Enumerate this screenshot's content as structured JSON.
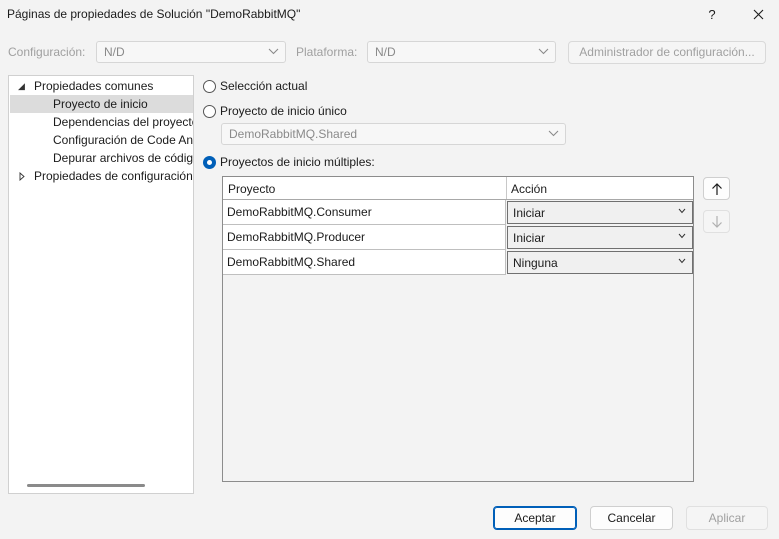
{
  "window": {
    "title": "Páginas de propiedades de Solución \"DemoRabbitMQ\"",
    "help_glyph": "?",
    "close_glyph": "✕"
  },
  "config_bar": {
    "configuration_label": "Configuración:",
    "configuration_value": "N/D",
    "platform_label": "Plataforma:",
    "platform_value": "N/D",
    "config_manager_label": "Administrador de configuración..."
  },
  "tree": {
    "items": [
      {
        "label": "Propiedades comunes",
        "expanded": true
      },
      {
        "label": "Proyecto de inicio",
        "selected": true
      },
      {
        "label": "Dependencias del proyecto"
      },
      {
        "label": "Configuración de Code Analysis"
      },
      {
        "label": "Depurar archivos de código fuente"
      },
      {
        "label": "Propiedades de configuración",
        "expanded": false
      }
    ]
  },
  "startup": {
    "current_selection_label": "Selección actual",
    "single_label": "Proyecto de inicio único",
    "single_value": "DemoRabbitMQ.Shared",
    "multiple_label": "Proyectos de inicio múltiples:",
    "selected_option": "multiple"
  },
  "grid": {
    "headers": {
      "project": "Proyecto",
      "action": "Acción"
    },
    "rows": [
      {
        "project": "DemoRabbitMQ.Consumer",
        "action": "Iniciar"
      },
      {
        "project": "DemoRabbitMQ.Producer",
        "action": "Iniciar"
      },
      {
        "project": "DemoRabbitMQ.Shared",
        "action": "Ninguna"
      }
    ]
  },
  "move": {
    "up_glyph": "↑",
    "down_glyph": "↓"
  },
  "buttons": {
    "ok": "Aceptar",
    "cancel": "Cancelar",
    "apply": "Aplicar"
  },
  "colors": {
    "accent": "#005fb8",
    "background": "#f3f3f3",
    "disabled_text": "#a0a0a0"
  }
}
